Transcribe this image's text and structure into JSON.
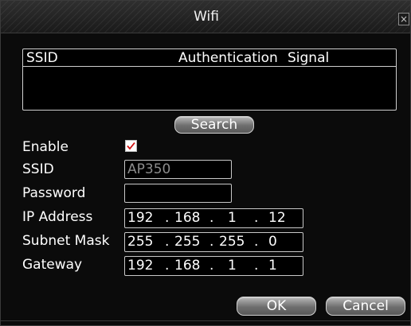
{
  "window": {
    "title": "Wifi",
    "close_glyph": "×"
  },
  "wifi_list": {
    "columns": [
      "SSID",
      "Authentication",
      "Signal"
    ],
    "rows": []
  },
  "search_button": "Search",
  "form": {
    "enable": {
      "label": "Enable",
      "checked": true
    },
    "ssid": {
      "label": "SSID",
      "value": "AP350"
    },
    "password": {
      "label": "Password",
      "value": ""
    },
    "ip_address": {
      "label": "IP Address",
      "octets": [
        "192",
        "168",
        "1",
        "12"
      ]
    },
    "subnet_mask": {
      "label": "Subnet Mask",
      "octets": [
        "255",
        "255",
        "255",
        "0"
      ]
    },
    "gateway": {
      "label": "Gateway",
      "octets": [
        "192",
        "168",
        "1",
        "1"
      ]
    }
  },
  "buttons": {
    "ok": "OK",
    "cancel": "Cancel"
  },
  "colors": {
    "background": "#0b0b0b",
    "border": "#cfcfcf",
    "check": "#d01010",
    "disabled_text": "#8c8c8c"
  }
}
